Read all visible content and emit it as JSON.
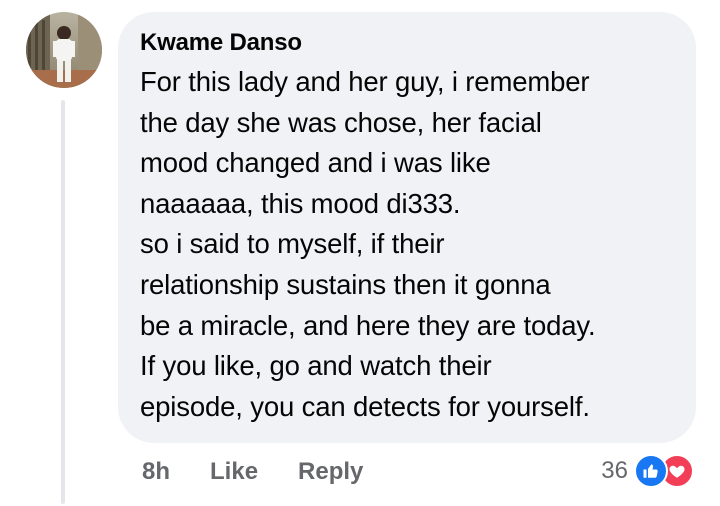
{
  "comment": {
    "author": "Kwame Danso",
    "text": "For this lady and her guy, i remember\nthe day she was chose, her facial\nmood changed and i was like\nnaaaaaa, this mood di333.\nso i said to myself, if their\nrelationship sustains then it gonna\nbe a miracle, and here they are today.\n If you like, go and watch their\nepisode, you can detects for yourself.",
    "time": "8h",
    "like_label": "Like",
    "reply_label": "Reply",
    "reaction_count": "36",
    "reactions": [
      "like-icon",
      "love-icon"
    ]
  },
  "colors": {
    "bubble_bg": "#f0f2f5",
    "meta_text": "#65676b",
    "like_blue": "#1877f2",
    "love_red": "#f33e58"
  }
}
